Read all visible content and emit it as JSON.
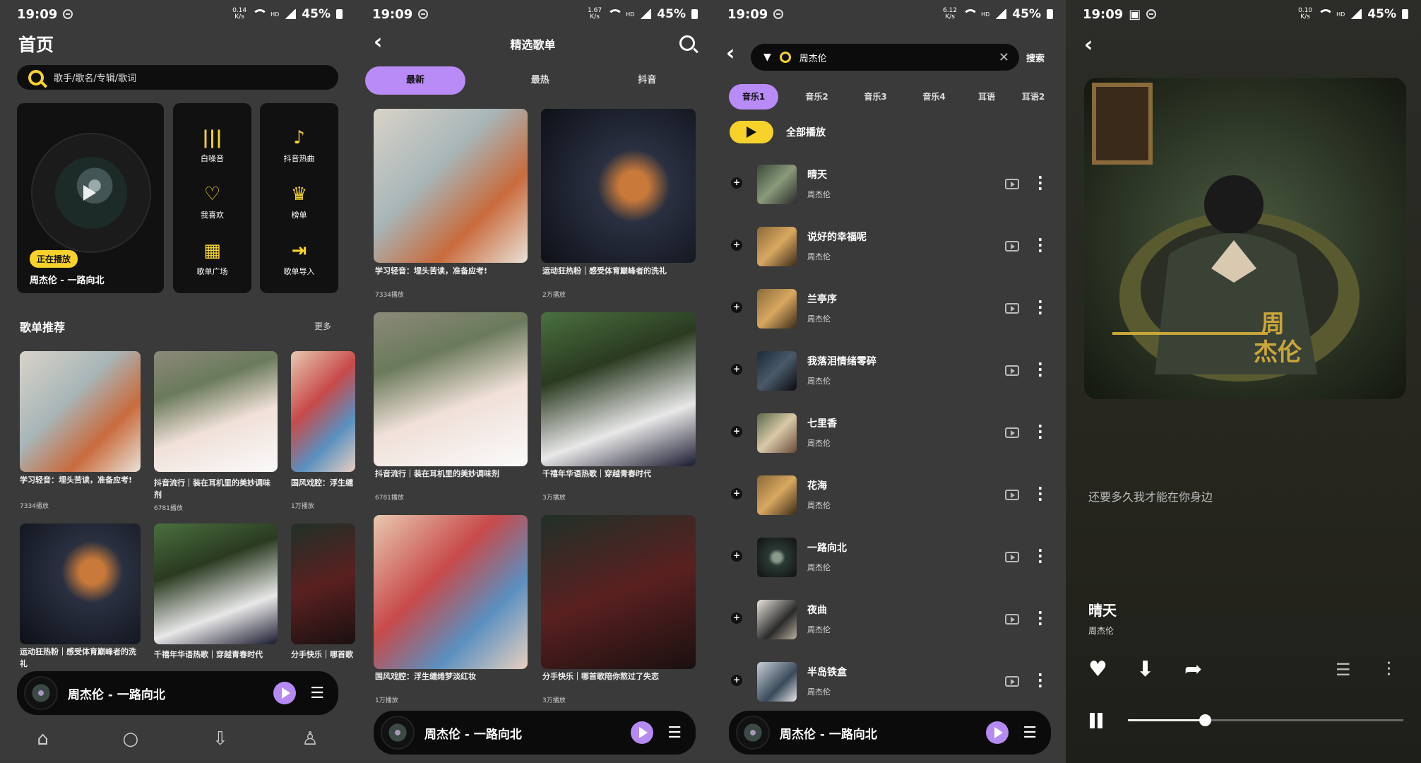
{
  "status": {
    "time": "19:09",
    "net1": "0.14\nK/s",
    "net2": "1.67\nK/s",
    "net3": "6.12\nK/s",
    "net4": "0.10\nK/s",
    "hd": "HD",
    "signal": "4G",
    "battery": "45%"
  },
  "home": {
    "title": "首页",
    "search_placeholder": "歌手/歌名/专辑/歌词",
    "now_playing_badge": "正在播放",
    "now_playing_song": "周杰伦 - 一路向北",
    "grid": [
      {
        "label": "白噪音",
        "icon": "sound-wave-icon"
      },
      {
        "label": "抖音热曲",
        "icon": "tiktok-icon"
      },
      {
        "label": "我喜欢",
        "icon": "heart-icon"
      },
      {
        "label": "榜单",
        "icon": "crown-icon"
      },
      {
        "label": "歌单广场",
        "icon": "grid-icon"
      },
      {
        "label": "歌单导入",
        "icon": "import-icon"
      }
    ],
    "section_title": "歌单推荐",
    "section_more": "更多",
    "playlists": [
      {
        "title": "学习轻音：埋头苦读，准备应考!",
        "count": "7334播放"
      },
      {
        "title": "抖音流行｜装在耳机里的美妙调味剂",
        "count": "6781播放"
      },
      {
        "title": "国风戏腔：浮生缱",
        "count": "1万播放"
      },
      {
        "title": "运动狂热粉｜感受体育巅峰者的洗礼",
        "count": ""
      },
      {
        "title": "千禧年华语热歌｜穿越青春时代",
        "count": ""
      },
      {
        "title": "分手快乐｜哪首歌",
        "count": ""
      }
    ],
    "nav": [
      "home-icon",
      "search-icon",
      "download-icon",
      "profile-icon"
    ]
  },
  "mini_player": {
    "title": "周杰伦 - 一路向北"
  },
  "playlists_page": {
    "title": "精选歌单",
    "tabs": [
      "最新",
      "最热",
      "抖音"
    ],
    "items": [
      {
        "title": "学习轻音：埋头苦读，准备应考!",
        "count": "7334播放"
      },
      {
        "title": "运动狂热粉｜感受体育巅峰者的洗礼",
        "count": "2万播放"
      },
      {
        "title": "抖音流行｜装在耳机里的美妙调味剂",
        "count": "6781播放"
      },
      {
        "title": "千禧年华语热歌｜穿越青春时代",
        "count": "3万播放"
      },
      {
        "title": "国风戏腔：浮生缱绻梦淡红妆",
        "count": "1万播放"
      },
      {
        "title": "分手快乐｜哪首歌陪你熬过了失恋",
        "count": "3万播放"
      }
    ]
  },
  "search_page": {
    "query": "周杰伦",
    "search_button": "搜索",
    "tabs": [
      "音乐1",
      "音乐2",
      "音乐3",
      "音乐4",
      "耳语",
      "耳语2"
    ],
    "play_all": "全部播放",
    "songs": [
      {
        "title": "晴天",
        "artist": "周杰伦"
      },
      {
        "title": "说好的幸福呢",
        "artist": "周杰伦"
      },
      {
        "title": "兰亭序",
        "artist": "周杰伦"
      },
      {
        "title": "我落泪情绪零碎",
        "artist": "周杰伦"
      },
      {
        "title": "七里香",
        "artist": "周杰伦"
      },
      {
        "title": "花海",
        "artist": "周杰伦"
      },
      {
        "title": "一路向北",
        "artist": "周杰伦"
      },
      {
        "title": "夜曲",
        "artist": "周杰伦"
      },
      {
        "title": "半岛铁盒",
        "artist": "周杰伦"
      }
    ]
  },
  "player": {
    "lyric": "还要多久我才能在你身边",
    "title": "晴天",
    "artist": "周杰伦",
    "progress": 0.28
  }
}
